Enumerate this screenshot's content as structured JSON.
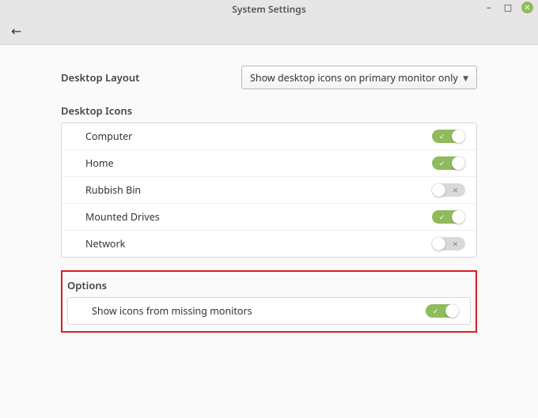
{
  "window": {
    "title": "System Settings"
  },
  "layout": {
    "label": "Desktop Layout",
    "selected": "Show desktop icons on primary monitor only"
  },
  "icons_section": {
    "label": "Desktop Icons",
    "items": [
      {
        "label": "Computer",
        "on": true
      },
      {
        "label": "Home",
        "on": true
      },
      {
        "label": "Rubbish Bin",
        "on": false
      },
      {
        "label": "Mounted Drives",
        "on": true
      },
      {
        "label": "Network",
        "on": false
      }
    ]
  },
  "options_section": {
    "label": "Options",
    "items": [
      {
        "label": "Show icons from missing monitors",
        "on": true
      }
    ]
  },
  "glyph": {
    "check": "✓",
    "cross": "✕",
    "back": "←",
    "chevron_down": "▼",
    "minimize": "–",
    "maximize": "□",
    "close": "✕"
  }
}
